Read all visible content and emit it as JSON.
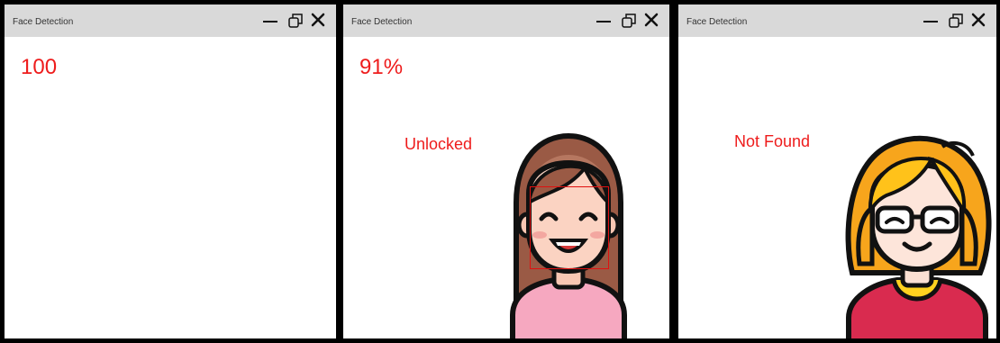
{
  "windows": [
    {
      "title": "Face Detection",
      "percent": "100",
      "status": ""
    },
    {
      "title": "Face Detection",
      "percent": "91%",
      "status": "Unlocked"
    },
    {
      "title": "Face Detection",
      "percent": "",
      "status": "Not Found"
    }
  ],
  "icons": {
    "minimize": "minimize-icon",
    "maximize": "restore-icon",
    "close": "close-icon"
  },
  "colors": {
    "text_red": "#ee1c1c",
    "detection_box": "#e01010",
    "titlebar": "#d9d9d9"
  }
}
